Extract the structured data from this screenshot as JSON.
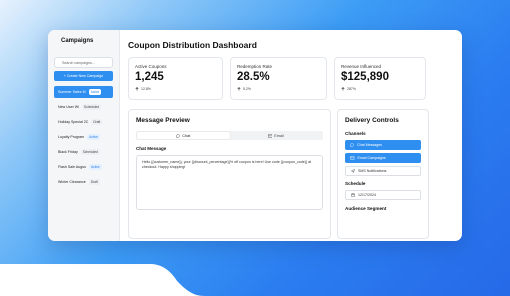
{
  "sidebar": {
    "title": "Campaigns",
    "search_placeholder": "Search campaigns...",
    "new_button": "+ Create New Campaign",
    "campaigns": [
      {
        "name": "Summer Sales M",
        "status": "Active",
        "active": true
      },
      {
        "name": "New User Wi",
        "status": "Scheduled",
        "active": false
      },
      {
        "name": "Holiday Special 2C",
        "status": "Draft",
        "active": false
      },
      {
        "name": "Loyalty Program",
        "status": "Active",
        "active": false
      },
      {
        "name": "Black Friday",
        "status": "Scheduled",
        "active": false
      },
      {
        "name": "Flash Sale Augus",
        "status": "Active",
        "active": false
      },
      {
        "name": "Winter Clearance",
        "status": "Draft",
        "active": false
      }
    ]
  },
  "dashboard": {
    "title": "Coupon Distribution Dashboard",
    "stats": [
      {
        "label": "Active Coupons",
        "value": "1,245",
        "change": "12.8%"
      },
      {
        "label": "Redemption Rate",
        "value": "28.5%",
        "change": "5.2%"
      },
      {
        "label": "Revenue Influenced",
        "value": "$125,890",
        "change": "287%"
      }
    ]
  },
  "preview": {
    "title": "Message Preview",
    "tab_chat": "Chat",
    "tab_email": "Email",
    "section_label": "Chat Message",
    "message": "Hello {{customer_name}}, your {{discount_percentage}}% off coupon is here! Use code {{coupon_code}} at checkout. Happy shopping!"
  },
  "delivery": {
    "title": "Delivery Controls",
    "channels_label": "Channels",
    "channels": [
      {
        "label": "Chat Messages",
        "on": true
      },
      {
        "label": "Email Campaigns",
        "on": true
      },
      {
        "label": "SMS Notifications",
        "on": false
      }
    ],
    "schedule_label": "Schedule",
    "date": "12/17/2024",
    "audience_label": "Audience Segment"
  },
  "colors": {
    "accent": "#2f8ff0",
    "background_blue": "#2b7df0"
  }
}
